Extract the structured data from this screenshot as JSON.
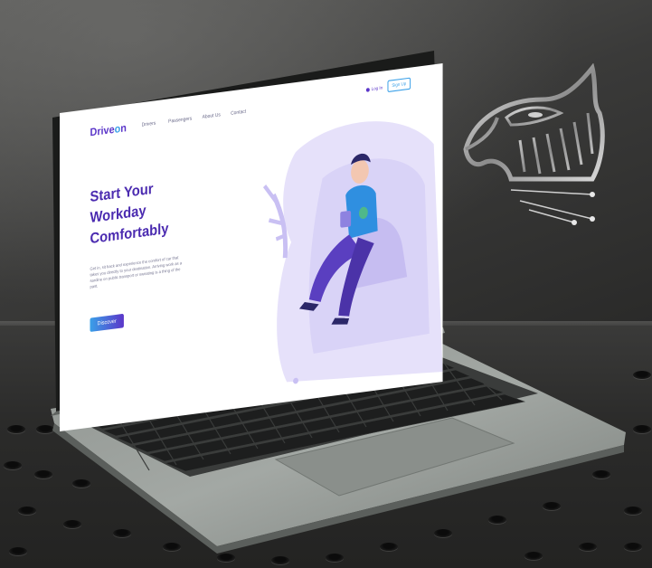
{
  "site": {
    "brand": {
      "prefix": "Drive",
      "o": "o",
      "suffix": "n"
    },
    "nav": {
      "items": [
        {
          "label": "Drivers"
        },
        {
          "label": "Passengers"
        },
        {
          "label": "About Us"
        },
        {
          "label": "Contact"
        }
      ],
      "login_label": "Log In",
      "signup_label": "Sign Up"
    },
    "hero": {
      "title_line1": "Start Your",
      "title_line2": "Workday",
      "title_line3": "Comfortably",
      "description": "Get in, sit back and experience the comfort of car that takes you directly to your destination. Arriving work as a sardine on public transport or sweating is a thing of the past.",
      "cta_label": "Discover"
    }
  },
  "colors": {
    "brand_purple": "#5b36c9",
    "brand_blue": "#3aa0e8",
    "illustration_lavender": "#d9d3f7",
    "shirt_blue": "#2f8fe0",
    "pants_purple": "#5a3fc0"
  },
  "icons": [
    "user-icon",
    "camera-notch-icon",
    "eagle-logo-icon"
  ]
}
